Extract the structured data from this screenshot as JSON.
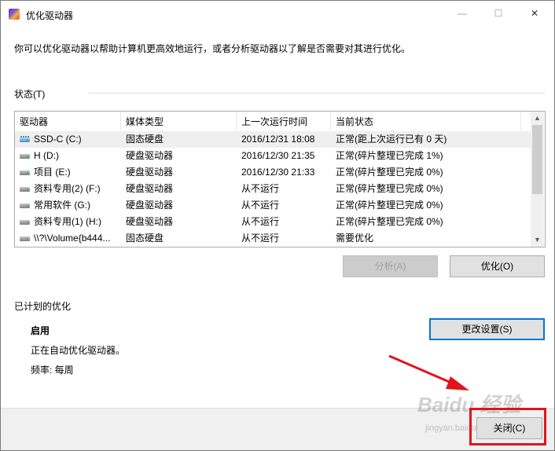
{
  "window": {
    "title": "优化驱动器",
    "minimize_glyph": "—",
    "maximize_glyph": "☐",
    "close_glyph": "✕"
  },
  "intro_text": "你可以优化驱动器以帮助计算机更高效地运行，或者分析驱动器以了解是否需要对其进行优化。",
  "status_section": {
    "label": "状态(T)",
    "columns": [
      "驱动器",
      "媒体类型",
      "上一次运行时间",
      "当前状态"
    ],
    "rows": [
      {
        "drive": "SSD-C (C:)",
        "icon": "ssd-drive-icon",
        "media": "固态硬盘",
        "last_run": "2016/12/31 18:08",
        "status": "正常(距上次运行已有 0 天)",
        "selected": true
      },
      {
        "drive": "H (D:)",
        "icon": "hard-drive-icon",
        "media": "硬盘驱动器",
        "last_run": "2016/12/30 21:35",
        "status": "正常(碎片整理已完成 1%)"
      },
      {
        "drive": "项目 (E:)",
        "icon": "hard-drive-icon",
        "media": "硬盘驱动器",
        "last_run": "2016/12/30 21:33",
        "status": "正常(碎片整理已完成 0%)"
      },
      {
        "drive": "资料专用(2) (F:)",
        "icon": "hard-drive-icon",
        "media": "硬盘驱动器",
        "last_run": "从不运行",
        "status": "正常(碎片整理已完成 0%)"
      },
      {
        "drive": "常用软件 (G:)",
        "icon": "hard-drive-icon",
        "media": "硬盘驱动器",
        "last_run": "从不运行",
        "status": "正常(碎片整理已完成 0%)"
      },
      {
        "drive": "资料专用(1) (H:)",
        "icon": "hard-drive-icon",
        "media": "硬盘驱动器",
        "last_run": "从不运行",
        "status": "正常(碎片整理已完成 0%)"
      },
      {
        "drive": "\\\\?\\Volume{b444...",
        "icon": "hard-drive-icon",
        "media": "固态硬盘",
        "last_run": "从不运行",
        "status": "需要优化"
      }
    ],
    "analyze_button": "分析(A)",
    "optimize_button": "优化(O)"
  },
  "scheduled_section": {
    "label": "已计划的优化",
    "state": "启用",
    "description": "正在自动优化驱动器。",
    "frequency": "频率: 每周",
    "change_settings_button": "更改设置(S)"
  },
  "footer": {
    "close_button": "关闭(C)"
  },
  "watermark": {
    "text": "Baidu 经验",
    "sub": "jingyan.baidu.com"
  },
  "colors": {
    "highlight_box": "#e0151b",
    "arrow": "#e0151b",
    "default_button_border": "#0078d7"
  }
}
